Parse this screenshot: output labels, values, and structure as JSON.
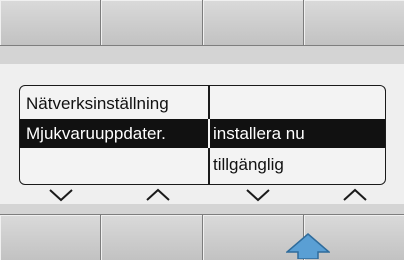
{
  "top_softkeys": [
    "",
    "",
    "",
    ""
  ],
  "bottom_softkeys": [
    "",
    "",
    "",
    ""
  ],
  "menu": {
    "rows": [
      {
        "left": "Nätverksinställning",
        "right": "",
        "selected": false
      },
      {
        "left": "Mjukvaruuppdater.",
        "right": "installera nu",
        "selected": true
      },
      {
        "left": "",
        "right": "tillgänglig",
        "selected": false
      }
    ]
  },
  "nav_icons": [
    "chevron-down-icon",
    "chevron-up-icon",
    "chevron-down-icon",
    "chevron-up-icon"
  ],
  "colors": {
    "selection": "#111111",
    "softkey": "#c9c9c9",
    "arrow_accent": "#5a9fd4"
  }
}
